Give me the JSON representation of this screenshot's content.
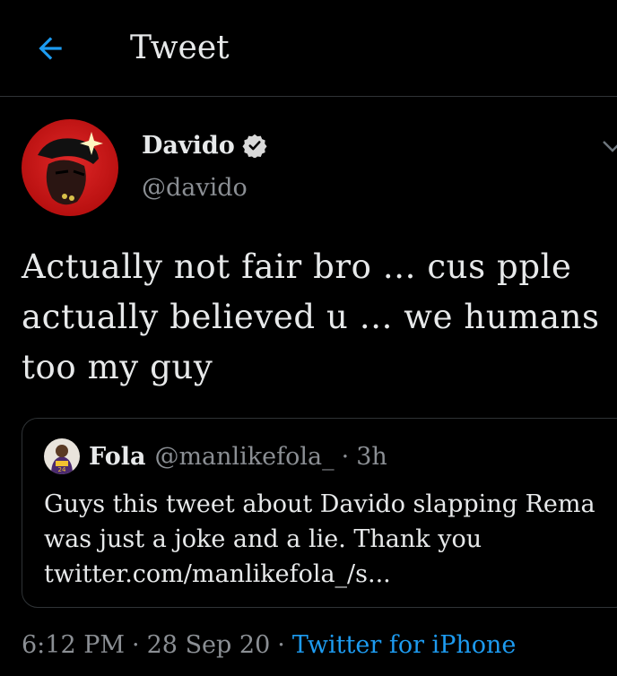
{
  "header": {
    "title": "Tweet",
    "back_icon": "arrow-left-icon"
  },
  "tweet": {
    "author_name": "Davido",
    "author_handle": "@davido",
    "verified_icon": "verified-badge-icon",
    "lines": [
      "Actually not fair bro ... cus pple",
      "actually believed u ... we humans",
      "too my guy"
    ]
  },
  "quote": {
    "name": "Fola",
    "handle": "@manlikefola_",
    "separator": "·",
    "time": "3h",
    "lines": [
      "Guys this tweet about Davido slapping Rema",
      "was just a joke and a lie. Thank you",
      "twitter.com/manlikefola_/s..."
    ]
  },
  "meta": {
    "time": "6:12 PM",
    "separator": "·",
    "date": "28 Sep 20",
    "source": "Twitter for iPhone"
  },
  "colors": {
    "background": "#000000",
    "accent": "#1d9bf0",
    "text": "#e7e9ea",
    "muted": "#8b8f94",
    "border": "#2f3336"
  }
}
